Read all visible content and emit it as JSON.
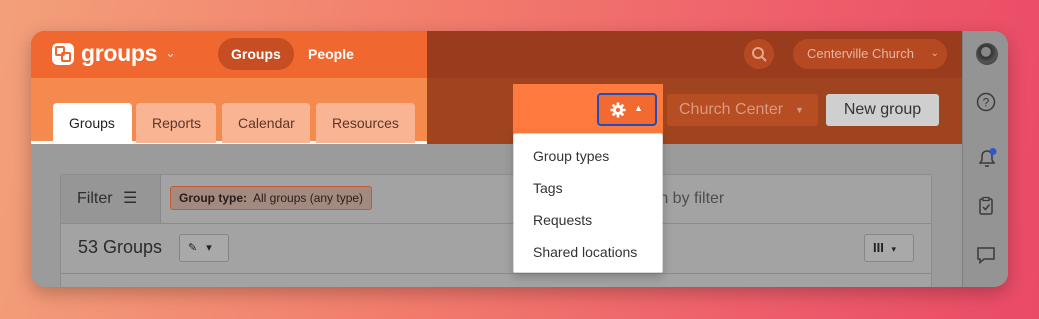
{
  "app": {
    "title": "groups",
    "nav_active": "Groups",
    "nav_other": "People"
  },
  "header": {
    "org": "Centerville Church"
  },
  "tabs": [
    {
      "label": "Groups",
      "active": true
    },
    {
      "label": "Reports",
      "active": false
    },
    {
      "label": "Calendar",
      "active": false
    },
    {
      "label": "Resources",
      "active": false
    }
  ],
  "actions": {
    "church_center": "Church Center",
    "new_group": "New group"
  },
  "settings_menu": {
    "items": [
      "Group types",
      "Tags",
      "Requests",
      "Shared locations"
    ]
  },
  "filter": {
    "label": "Filter",
    "chip_key": "Group type:",
    "chip_value": "All groups (any type)",
    "search_placeholder": "rch by filter"
  },
  "list": {
    "count": "53 Groups",
    "columns_glyph": "III"
  },
  "colors": {
    "brand_orange": "#f0682f",
    "tab_orange": "#f9b493",
    "focus_blue": "#1f4fbf"
  },
  "icons": [
    "groups-logo-icon",
    "search-icon",
    "gear-icon",
    "help-icon",
    "bell-icon",
    "clipboard-icon",
    "chat-icon",
    "pencil-icon",
    "filter-icon"
  ]
}
